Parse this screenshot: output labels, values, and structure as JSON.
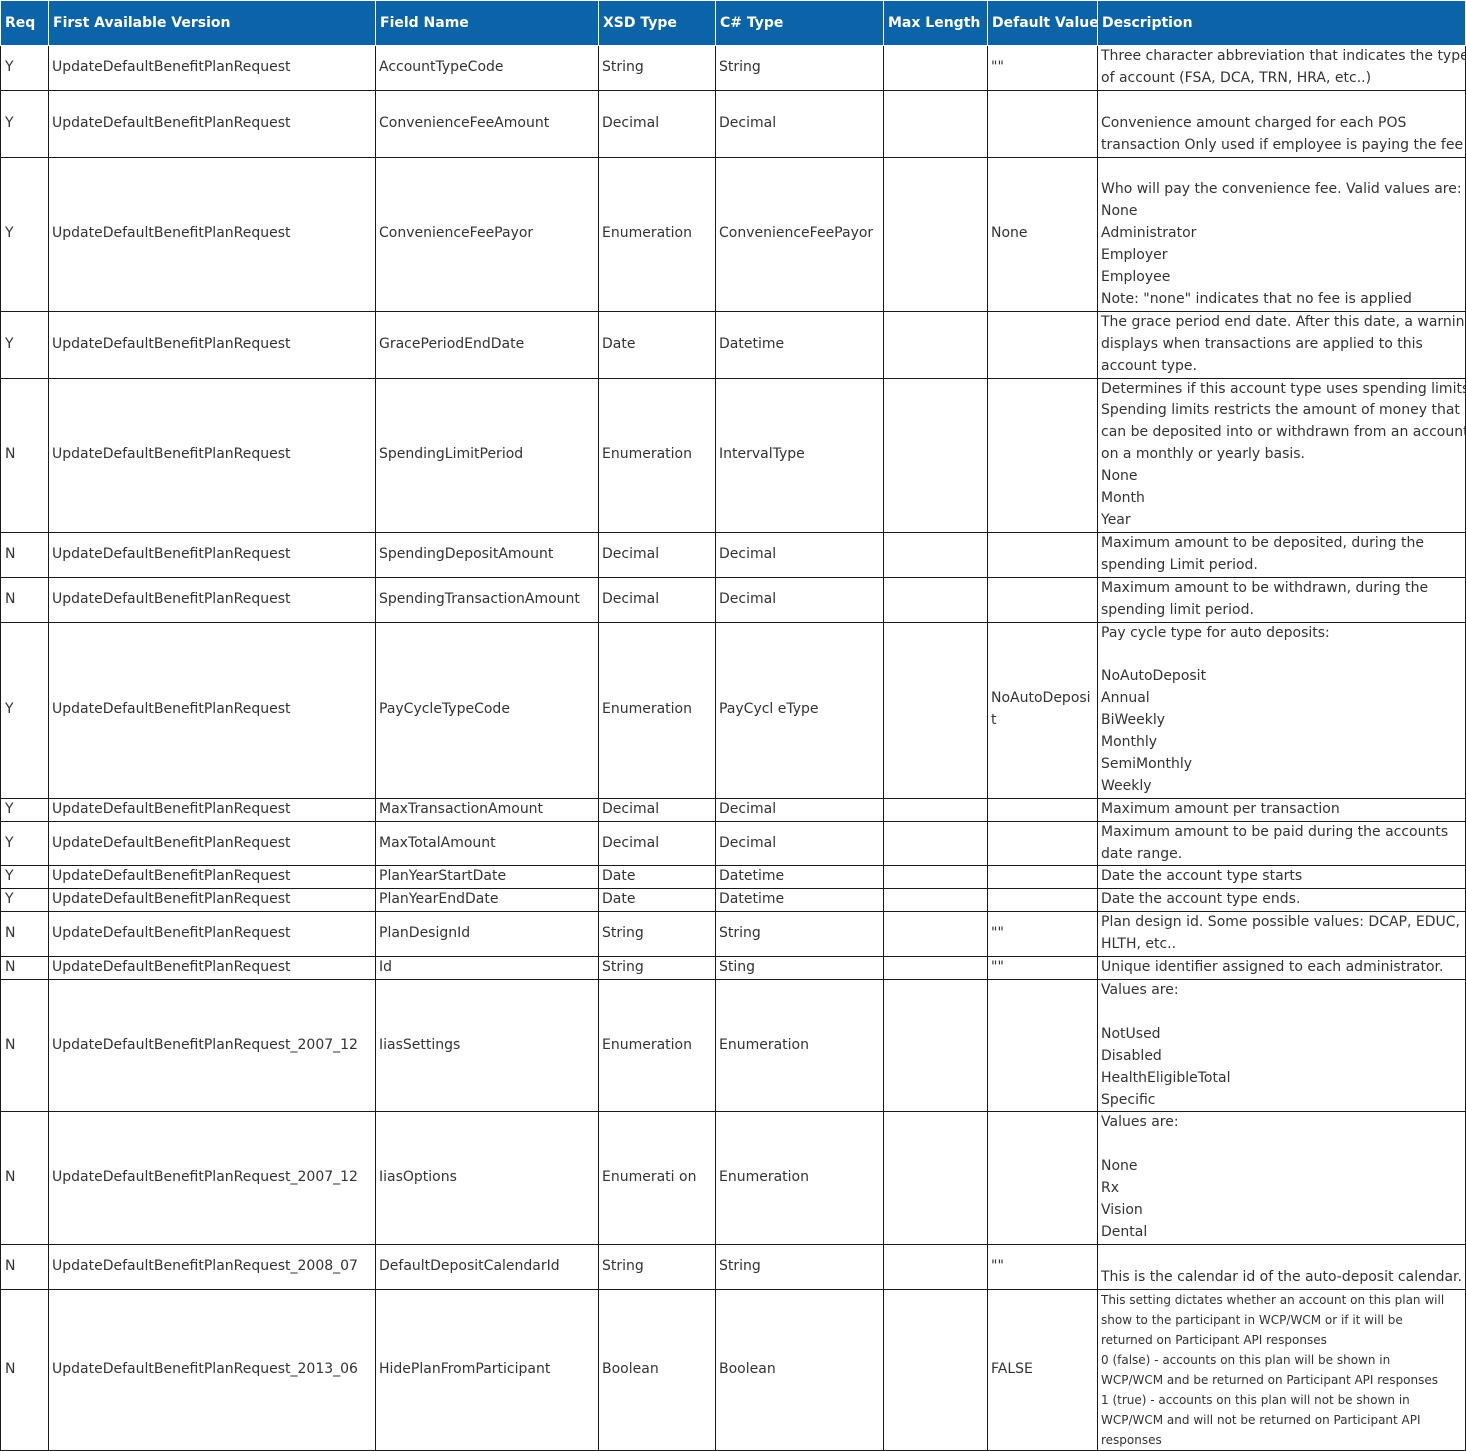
{
  "headers": [
    "Req",
    "First Available Version",
    "Field Name",
    "XSD Type",
    "C# Type",
    "Max Length",
    "Default Value",
    "Description"
  ],
  "rows": [
    {
      "req": "Y",
      "version": "UpdateDefaultBenefitPlanRequest",
      "field": "AccountTypeCode",
      "xsd": "String",
      "cs": "String",
      "max": "",
      "def": "\"\"",
      "desc": [
        "Three character abbreviation that indicates the type",
        "of account (FSA, DCA, TRN, HRA, etc..)"
      ]
    },
    {
      "req": "Y",
      "version": "UpdateDefaultBenefitPlanRequest",
      "field": "ConvenienceFeeAmount",
      "xsd": "Decimal",
      "cs": "Decimal",
      "max": "",
      "def": "",
      "desc": [
        "",
        "Convenience amount charged for each POS",
        "transaction Only used if employee is paying the fee"
      ]
    },
    {
      "req": "Y",
      "version": "UpdateDefaultBenefitPlanRequest",
      "field": "ConvenienceFeePayor",
      "xsd": "Enumeration",
      "cs": "ConvenienceFeePayor",
      "max": "",
      "def": "None",
      "desc": [
        "",
        "Who will pay the convenience fee. Valid values are:",
        "None",
        "Administrator",
        "Employer",
        "Employee",
        "Note: \"none\" indicates that no fee is applied"
      ]
    },
    {
      "req": "Y",
      "version": "UpdateDefaultBenefitPlanRequest",
      "field": "GracePeriodEndDate",
      "xsd": "Date",
      "cs": "Datetime",
      "max": "",
      "def": "",
      "desc": [
        "The grace period end date. After this date, a warning",
        "displays when transactions are applied to this",
        "account type."
      ]
    },
    {
      "req": "N",
      "version": "UpdateDefaultBenefitPlanRequest",
      "field": "SpendingLimitPeriod",
      "xsd": "Enumeration",
      "cs": "IntervalType",
      "max": "",
      "def": "",
      "desc": [
        "Determines if this account type uses spending limits.",
        "Spending limits restricts the amount of money that",
        "can be deposited into or withdrawn from an account",
        "on a monthly or yearly basis.",
        "None",
        "Month",
        "Year"
      ]
    },
    {
      "req": "N",
      "version": "UpdateDefaultBenefitPlanRequest",
      "field": "SpendingDepositAmount",
      "xsd": "Decimal",
      "cs": "Decimal",
      "max": "",
      "def": "",
      "desc": [
        "Maximum amount to be deposited, during the",
        "spending Limit period."
      ]
    },
    {
      "req": "N",
      "version": "UpdateDefaultBenefitPlanRequest",
      "field": "SpendingTransactionAmount",
      "xsd": "Decimal",
      "cs": "Decimal",
      "max": "",
      "def": "",
      "desc": [
        "Maximum amount to be withdrawn, during the",
        "spending limit period."
      ]
    },
    {
      "req": "Y",
      "version": "UpdateDefaultBenefitPlanRequest",
      "field": "PayCycleTypeCode",
      "xsd": "Enumeration",
      "cs": "PayCycl eType",
      "max": "",
      "def": "NoAutoDeposi\nt",
      "desc": [
        "Pay cycle type for auto deposits:",
        "",
        "NoAutoDeposit",
        "Annual",
        "BiWeekly",
        "Monthly",
        "SemiMonthly",
        "Weekly"
      ]
    },
    {
      "req": "Y",
      "version": "UpdateDefaultBenefitPlanRequest",
      "field": "MaxTransactionAmount",
      "xsd": "Decimal",
      "cs": "Decimal",
      "max": "",
      "def": "",
      "desc": [
        "Maximum amount per transaction"
      ]
    },
    {
      "req": "Y",
      "version": "UpdateDefaultBenefitPlanRequest",
      "field": "MaxTotalAmount",
      "xsd": "Decimal",
      "cs": "Decimal",
      "max": "",
      "def": "",
      "desc": [
        "Maximum amount to be paid during the accounts",
        "date range."
      ]
    },
    {
      "req": "Y",
      "version": "UpdateDefaultBenefitPlanRequest",
      "field": "PlanYearStartDate",
      "xsd": "Date",
      "cs": "Datetime",
      "max": "",
      "def": "",
      "desc": [
        "Date the account type starts"
      ]
    },
    {
      "req": "Y",
      "version": "UpdateDefaultBenefitPlanRequest",
      "field": "PlanYearEndDate",
      "xsd": "Date",
      "cs": "Datetime",
      "max": "",
      "def": "",
      "desc": [
        "Date the account type ends."
      ]
    },
    {
      "req": "N",
      "version": "UpdateDefaultBenefitPlanRequest",
      "field": "PlanDesignId",
      "xsd": "String",
      "cs": "String",
      "max": "",
      "def": "\"\"",
      "desc": [
        "Plan design id. Some possible values: DCAP, EDUC,",
        "HLTH, etc.."
      ]
    },
    {
      "req": "N",
      "version": "UpdateDefaultBenefitPlanRequest",
      "field": "Id",
      "xsd": "String",
      "cs": "Sting",
      "max": "",
      "def": "\"\"",
      "desc": [
        "Unique identifier assigned to each administrator."
      ]
    },
    {
      "req": "N",
      "version": "UpdateDefaultBenefitPlanRequest_2007_12",
      "field": "IiasSettings",
      "xsd": "Enumeration",
      "cs": "Enumeration",
      "max": "",
      "def": "",
      "desc": [
        "Values are:",
        "",
        "NotUsed",
        "Disabled",
        "HealthEligibleTotal",
        "Specific"
      ]
    },
    {
      "req": "N",
      "version": "UpdateDefaultBenefitPlanRequest_2007_12",
      "field": "IiasOptions",
      "xsd": "Enumerati on",
      "cs": "Enumeration",
      "max": "",
      "def": "",
      "desc": [
        "Values are:",
        "",
        "None",
        "Rx",
        "Vision",
        "Dental"
      ]
    },
    {
      "req": "N",
      "version": "UpdateDefaultBenefitPlanRequest_2008_07",
      "field": "DefaultDepositCalendarId",
      "xsd": "String",
      "cs": "String",
      "max": "",
      "def": "\"\"",
      "desc": [
        "",
        "This is the calendar id of the auto-deposit calendar."
      ]
    },
    {
      "req": "N",
      "version": "UpdateDefaultBenefitPlanRequest_2013_06",
      "field": "HidePlanFromParticipant",
      "xsd": "Boolean",
      "cs": "Boolean",
      "max": "",
      "def": "FALSE",
      "small": true,
      "desc": [
        "This setting dictates whether an account on this plan will",
        "show to the participant in WCP/WCM or if it will be",
        "returned on Participant API responses",
        "0  (false) - accounts on this plan will be shown in",
        "WCP/WCM and be returned on Participant API responses",
        "1 (true) - accounts on this plan will not be shown in",
        "WCP/WCM and will not be returned on Participant API",
        "responses"
      ]
    }
  ]
}
